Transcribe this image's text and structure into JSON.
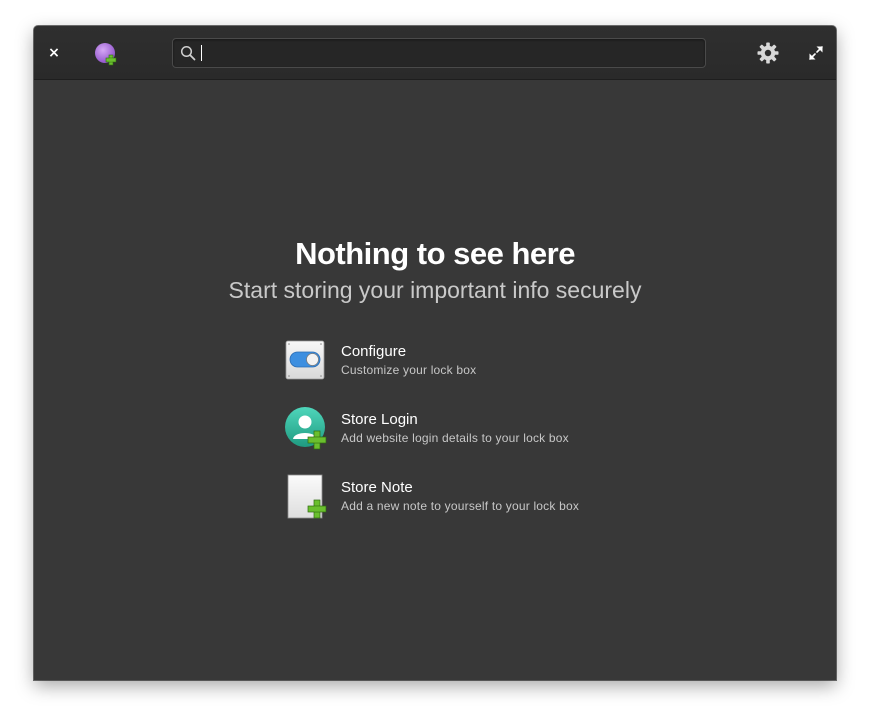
{
  "headerbar": {
    "close_glyph": "×",
    "add_icon": "purple-circle-plus-icon",
    "search": {
      "value": "",
      "placeholder": ""
    },
    "settings_icon": "gear-icon",
    "maximize_icon": "maximize-arrows-icon"
  },
  "welcome": {
    "title": "Nothing to see here",
    "subtitle": "Start storing your important info securely"
  },
  "actions": [
    {
      "label": "Configure",
      "description": "Customize your lock box",
      "icon": "toggle-switch-icon"
    },
    {
      "label": "Store Login",
      "description": "Add website login details to your lock box",
      "icon": "user-add-icon"
    },
    {
      "label": "Store Note",
      "description": "Add a new note to yourself to your lock box",
      "icon": "note-add-icon"
    }
  ],
  "colors": {
    "window_bg": "#383838",
    "headerbar_bg": "#2d2d2d",
    "accent_green": "#6abf2e",
    "accent_teal": "#2bb59a",
    "accent_purple": "#a66cd8"
  }
}
